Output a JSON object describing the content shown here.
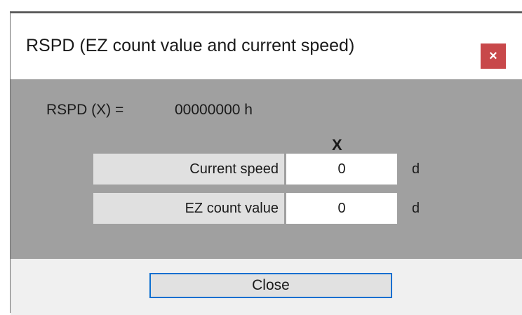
{
  "window": {
    "title": "RSPD (EZ count value and current speed)",
    "close_icon_label": "×",
    "accent_close": "#c8484a",
    "panel_color": "#a0a0a0"
  },
  "header": {
    "label": "RSPD (X) =",
    "value": "00000000 h"
  },
  "table": {
    "column_header": "X",
    "rows": [
      {
        "label": "Current speed",
        "value": "0",
        "unit": "d"
      },
      {
        "label": "EZ count value",
        "value": "0",
        "unit": "d"
      }
    ]
  },
  "footer": {
    "close_button_label": "Close",
    "focus_color": "#0b6fd0"
  }
}
